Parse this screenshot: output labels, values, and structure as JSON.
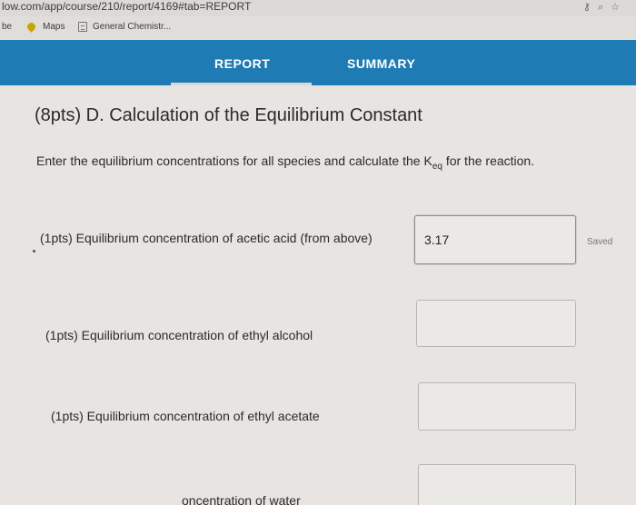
{
  "browser": {
    "url": "low.com/app/course/210/report/4169#tab=REPORT",
    "bookmarks": [
      {
        "label": "be"
      },
      {
        "label": "Maps"
      },
      {
        "label": "General Chemistr..."
      }
    ]
  },
  "nav": {
    "tabs": [
      {
        "label": "REPORT",
        "active": true
      },
      {
        "label": "SUMMARY",
        "active": false
      }
    ],
    "accent_color": "#1f7bb3"
  },
  "section": {
    "title": "(8pts) D. Calculation of the Equilibrium Constant",
    "instructions_pre": "Enter the equilibrium concentrations for all species and calculate the K",
    "instructions_sub": "eq",
    "instructions_post": " for the reaction."
  },
  "questions": [
    {
      "label": "(1pts) Equilibrium concentration of acetic acid (from above)",
      "value": "3.17",
      "status": "Saved"
    },
    {
      "label": "(1pts) Equilibrium concentration of ethyl alcohol",
      "value": ""
    },
    {
      "label": "(1pts) Equilibrium concentration of ethyl acetate",
      "value": ""
    },
    {
      "label": "oncentration of water",
      "value": ""
    }
  ]
}
